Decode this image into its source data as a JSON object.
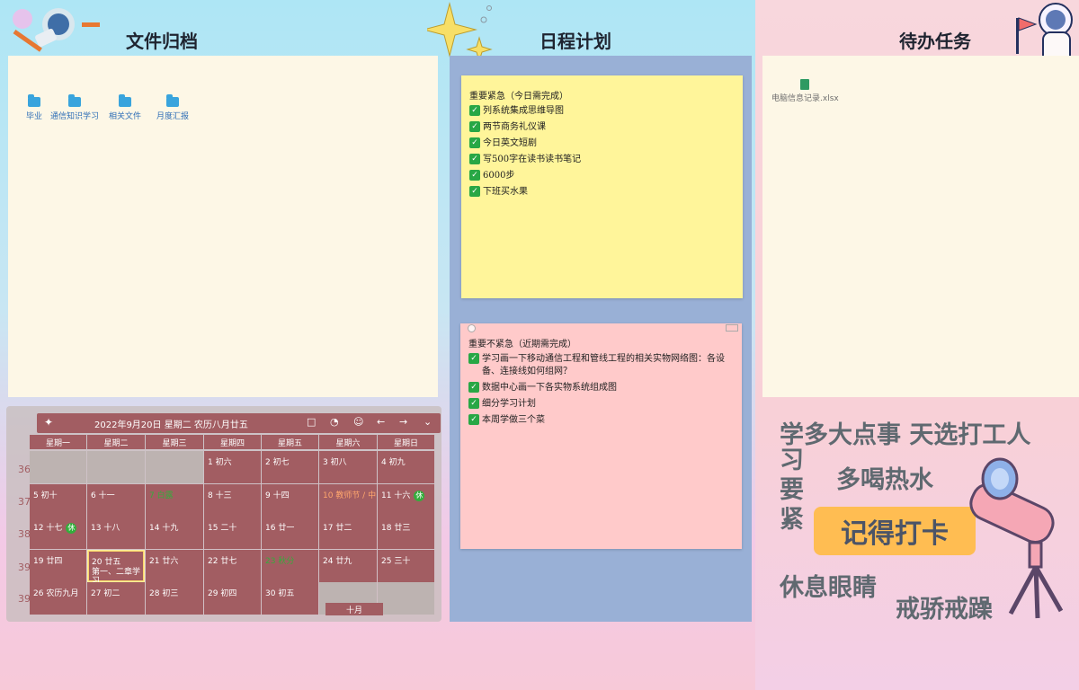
{
  "sections": {
    "files": "文件归档",
    "schedule": "日程计划",
    "todo": "待办任务"
  },
  "folders": [
    "毕业",
    "通信知识学习",
    "相关文件",
    "月度汇报"
  ],
  "todo_file": "电脑信息记录.xlsx",
  "notes": {
    "urgent": {
      "title": "重要紧急（今日需完成）",
      "items": [
        "列系统集成思维导图",
        "两节商务礼仪课",
        "今日英文短剧",
        "写500字在读书读书笔记",
        "6000步",
        "下班买水果"
      ]
    },
    "not_urgent": {
      "title": "重要不紧急（近期需完成）",
      "items": [
        "学习画一下移动通信工程和管线工程的相关实物网络图：各设备、连接线如何组网？",
        "数据中心画一下各实物系统组成图",
        "细分学习计划",
        "本周学做三个菜"
      ]
    }
  },
  "calendar": {
    "header": "2022年9月20日 星期二 农历八月廿五",
    "weekdays": [
      "星期一",
      "星期二",
      "星期三",
      "星期四",
      "星期五",
      "星期六",
      "星期日"
    ],
    "weeks": [
      "36",
      "37",
      "38",
      "39",
      "39"
    ],
    "days": [
      "",
      "",
      "",
      "1 初六",
      "2 初七",
      "3 初八",
      "4 初九",
      "5 初十",
      "6 十一",
      "7 白露",
      "8 十三",
      "9 十四",
      "10 教师节 / 中",
      "11 十六",
      "12 十七",
      "13 十八",
      "14 十九",
      "15 二十",
      "16 廿一",
      "17 廿二",
      "18 廿三",
      "19 廿四",
      "20 廿五",
      "21 廿六",
      "22 廿七",
      "23 秋分",
      "24 廿九",
      "25 三十",
      "26 农历九月",
      "27 初二",
      "28 初三",
      "29 初四",
      "30 初五",
      "",
      ""
    ],
    "today_note": "第一、二章学习",
    "rest_badge": "休",
    "month_label": "十月"
  },
  "slogans": {
    "l1": "学多大点事 天选打工人",
    "l2": "习要紧",
    "l3": "多喝热水",
    "l4": "记得打卡",
    "l5": "休息眼睛",
    "l6": "戒骄戒躁"
  }
}
